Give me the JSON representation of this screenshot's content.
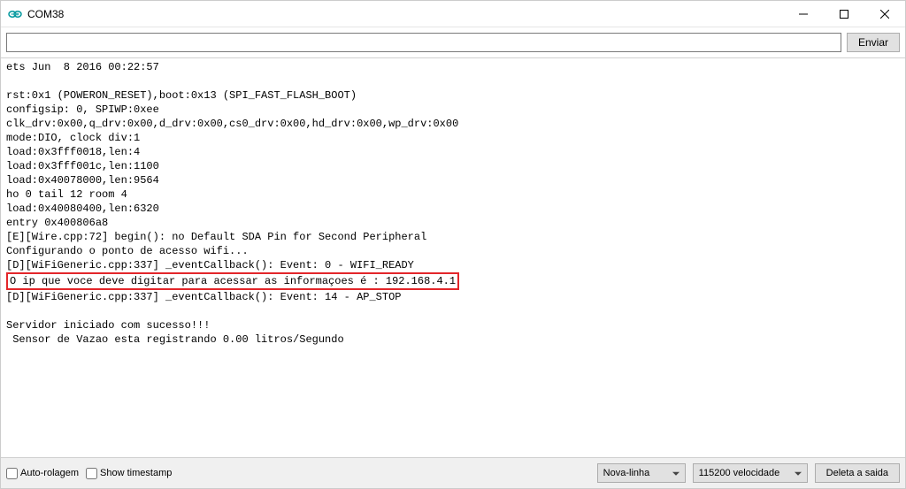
{
  "window": {
    "title": "COM38"
  },
  "toolbar": {
    "send_label": "Enviar",
    "input_value": ""
  },
  "output": {
    "lines": [
      "ets Jun  8 2016 00:22:57",
      "",
      "rst:0x1 (POWERON_RESET),boot:0x13 (SPI_FAST_FLASH_BOOT)",
      "configsip: 0, SPIWP:0xee",
      "clk_drv:0x00,q_drv:0x00,d_drv:0x00,cs0_drv:0x00,hd_drv:0x00,wp_drv:0x00",
      "mode:DIO, clock div:1",
      "load:0x3fff0018,len:4",
      "load:0x3fff001c,len:1100",
      "load:0x40078000,len:9564",
      "ho 0 tail 12 room 4",
      "load:0x40080400,len:6320",
      "entry 0x400806a8",
      "[E][Wire.cpp:72] begin(): no Default SDA Pin for Second Peripheral",
      "Configurando o ponto de acesso wifi...",
      "[D][WiFiGeneric.cpp:337] _eventCallback(): Event: 0 - WIFI_READY"
    ],
    "highlighted_line": "O ip que voce deve digitar para acessar as informaçoes é : 192.168.4.1",
    "lines_after": [
      "[D][WiFiGeneric.cpp:337] _eventCallback(): Event: 14 - AP_STOP",
      "",
      "Servidor iniciado com sucesso!!!",
      " Sensor de Vazao esta registrando 0.00 litros/Segundo"
    ]
  },
  "footer": {
    "autoscroll_label": "Auto-rolagem",
    "timestamp_label": "Show timestamp",
    "line_ending_selected": "Nova-linha",
    "baud_selected": "115200 velocidade",
    "clear_label": "Deleta a saida"
  }
}
